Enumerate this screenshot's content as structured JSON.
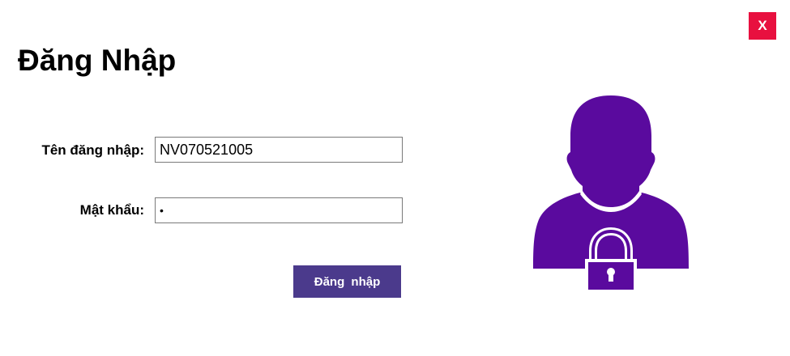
{
  "dialog": {
    "title": "Đăng Nhập",
    "close_label": "X"
  },
  "form": {
    "username_label": "Tên đăng nhập:",
    "username_value": "NV070521005",
    "password_label": "Mật khẩu:",
    "password_value": "•",
    "submit_label": "Đăng  nhập"
  },
  "icons": {
    "illustration": "user-lock-icon"
  },
  "colors": {
    "accent": "#5a0a9e",
    "button": "#4b3a8c",
    "close": "#e8103f"
  }
}
